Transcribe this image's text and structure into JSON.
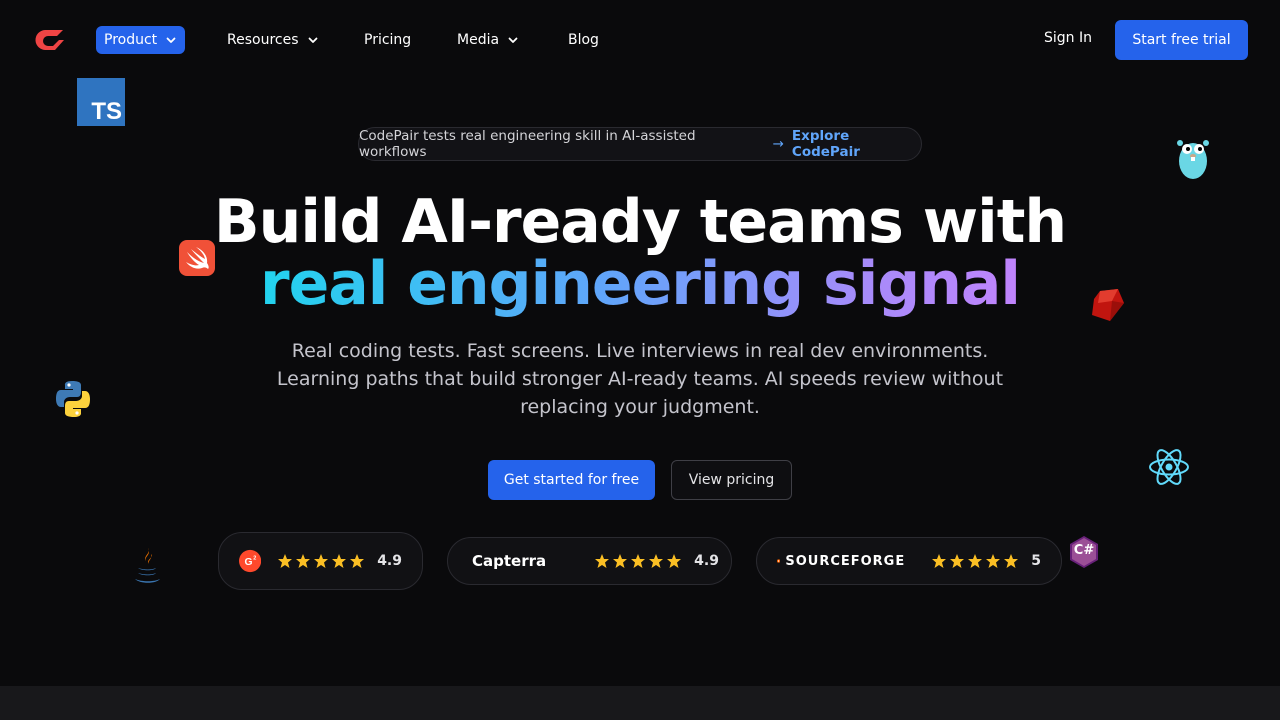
{
  "nav": {
    "items": [
      {
        "label": "Product",
        "has_dropdown": true,
        "active": true
      },
      {
        "label": "Resources",
        "has_dropdown": true,
        "active": false
      },
      {
        "label": "Pricing",
        "has_dropdown": false,
        "active": false
      },
      {
        "label": "Media",
        "has_dropdown": true,
        "active": false
      },
      {
        "label": "Blog",
        "has_dropdown": false,
        "active": false
      }
    ],
    "sign_in": "Sign In",
    "trial": "Start free trial"
  },
  "announcement": {
    "text": "CodePair tests real engineering skill in AI-assisted workflows",
    "arrow": "→",
    "link": "Explore CodePair"
  },
  "hero": {
    "line1": "Build AI-ready teams with",
    "line2": "real engineering signal",
    "subtitle": "Real coding tests. Fast screens. Live interviews in real dev environments. Learning paths that build stronger AI-ready teams. AI speeds review without replacing your judgment.",
    "primary_cta": "Get started for free",
    "secondary_cta": "View pricing"
  },
  "ratings": [
    {
      "brand": "G2",
      "logo": "g2-logo",
      "stars": 5,
      "score": "4.9"
    },
    {
      "brand": "Capterra",
      "logo": "capterra-logo",
      "stars": 5,
      "score": "4.9"
    },
    {
      "brand": "SOURCEFORGE",
      "logo": "sourceforge-logo",
      "stars": 5,
      "score": "5"
    }
  ],
  "floating_icons": {
    "typescript": "TS",
    "csharp": "C#"
  },
  "colors": {
    "background": "#0a0a0c",
    "accent": "#2563eb",
    "link": "#60a5fa",
    "star": "#fbbf24",
    "logo_red": "#ef4444"
  }
}
